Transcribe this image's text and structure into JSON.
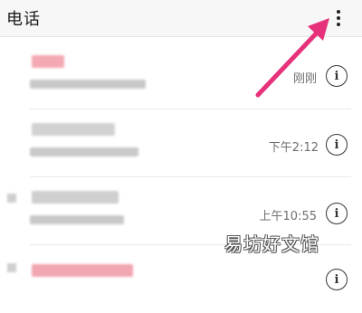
{
  "header": {
    "title": "电话",
    "more_icon": "more-vert-icon"
  },
  "calls": [
    {
      "time": "刚刚",
      "info_icon": "info-icon"
    },
    {
      "time": "下午2:12",
      "info_icon": "info-icon"
    },
    {
      "time": "上午10:55",
      "info_icon": "info-icon"
    },
    {
      "time": "",
      "info_icon": "info-icon"
    }
  ],
  "colors": {
    "accent_arrow": "#e6317b",
    "missed_name": "#f4a9b2",
    "blur_text": "#c9c9c9"
  },
  "watermark": "易坊好文馆"
}
